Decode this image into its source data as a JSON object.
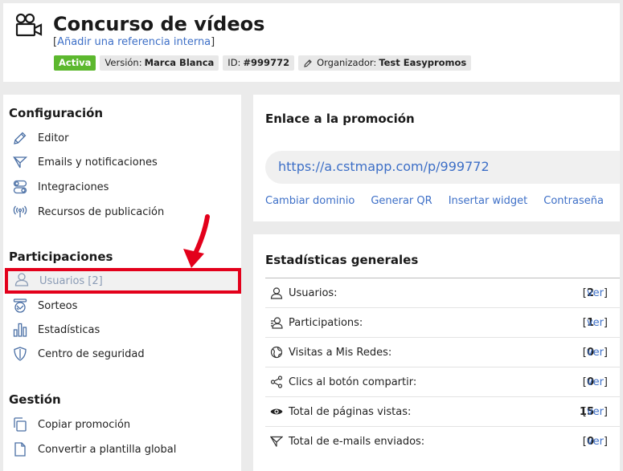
{
  "header": {
    "title": "Concurso de vídeos",
    "ref_open": "[",
    "ref_link": "Añadir una referencia interna",
    "ref_close": "]",
    "status": "Activa",
    "version_label": "Versión:",
    "version_value": "Marca Blanca",
    "id_label": "ID:",
    "id_value": "#999772",
    "organizer_label": "Organizador:",
    "organizer_value": "Test Easypromos"
  },
  "sidebar": {
    "config_title": "Configuración",
    "config_items": [
      {
        "label": "Editor",
        "icon": "pencil-icon"
      },
      {
        "label": "Emails y notificaciones",
        "icon": "send-icon"
      },
      {
        "label": "Integraciones",
        "icon": "toggles-icon"
      },
      {
        "label": "Recursos de publicación",
        "icon": "broadcast-icon"
      }
    ],
    "part_title": "Participaciones",
    "part_items": [
      {
        "label": "Usuarios [2]",
        "icon": "user-icon"
      },
      {
        "label": "Sorteos",
        "icon": "raffle-drum-icon"
      },
      {
        "label": "Estadísticas",
        "icon": "bar-chart-icon"
      },
      {
        "label": "Centro de seguridad",
        "icon": "shield-icon"
      }
    ],
    "gestion_title": "Gestión",
    "gestion_items": [
      {
        "label": "Copiar promoción",
        "icon": "copy-icon"
      },
      {
        "label": "Convertir a plantilla global",
        "icon": "file-icon"
      }
    ]
  },
  "link_panel": {
    "title": "Enlace a la promoción",
    "url": "https://a.cstmapp.com/p/999772",
    "actions": [
      "Cambiar dominio",
      "Generar QR",
      "Insertar widget",
      "Contraseña"
    ]
  },
  "stats": {
    "title": "Estadísticas generales",
    "ver_open": "[",
    "ver_label": "ver",
    "ver_close": "]",
    "rows": [
      {
        "label": "Usuarios:",
        "value": "2",
        "icon": "user-icon"
      },
      {
        "label": "Participations:",
        "value": "1",
        "icon": "participations-icon"
      },
      {
        "label": "Visitas a Mis Redes:",
        "value": "0",
        "icon": "globe-icon"
      },
      {
        "label": "Clics al botón compartir:",
        "value": "0",
        "icon": "share-icon"
      },
      {
        "label": "Total de páginas vistas:",
        "value": "15",
        "icon": "eye-icon"
      },
      {
        "label": "Total de e-mails enviados:",
        "value": "0",
        "icon": "send-icon"
      }
    ]
  },
  "colors": {
    "accent_link": "#3d6fc7",
    "active_badge": "#5cb82e",
    "highlight_border": "#e3001b"
  }
}
